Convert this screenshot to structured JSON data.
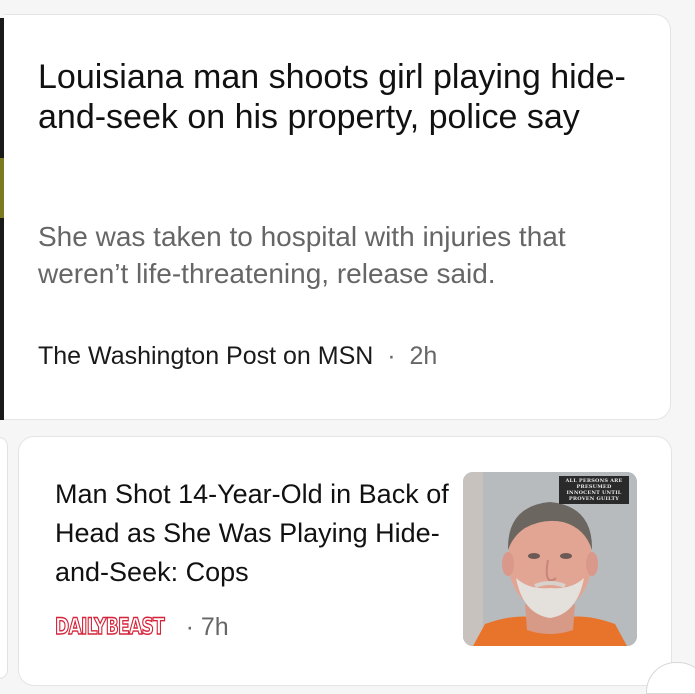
{
  "feed": {
    "articles": [
      {
        "title": "Louisiana man shoots girl playing hide-and-seek on his property, police say",
        "summary": "She was taken to hospital with injuries that weren’t life-threatening, release said.",
        "source": "The Washington Post on MSN",
        "separator": "·",
        "time": "2h"
      },
      {
        "title": "Man Shot 14-Year-Old in Back of Head as She Was Playing Hide-and-Seek: Cops",
        "source_logo": "DAILYBEAST",
        "separator": "·",
        "time": "7h",
        "thumbnail": {
          "icon": "mugshot-photo",
          "stamp": "ALL PERSONS ARE PRESUMED INNOCENT UNTIL PROVEN GUILTY"
        }
      }
    ]
  },
  "colors": {
    "title": "#111111",
    "summary": "#666666",
    "logo_red": "#d6243a",
    "card_border": "#e4e4e4",
    "page_background": "#f6f6f6"
  }
}
